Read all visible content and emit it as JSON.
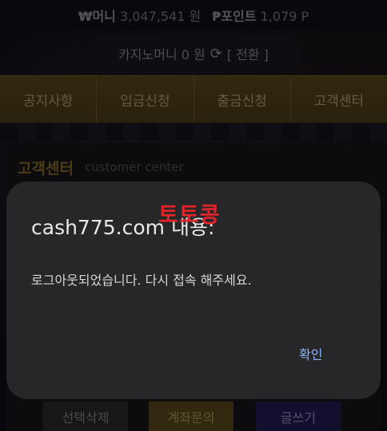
{
  "topbar": {
    "money_label": "₩머니",
    "money_value": "3,047,541 원",
    "point_label": "₱포인트",
    "point_value": "1,079 P"
  },
  "casino": {
    "label": "카지노머니 0 원",
    "swap_icon": "refresh-icon",
    "swap_label": "[ 전환 ]"
  },
  "nav": {
    "items": [
      {
        "label": "공지사항"
      },
      {
        "label": "입금신청"
      },
      {
        "label": "출금신청"
      },
      {
        "label": "고객센터"
      }
    ]
  },
  "panel": {
    "title": "고객센터",
    "subtitle": "customer center"
  },
  "bottom_buttons": {
    "delete_label": "선택삭제",
    "account_label": "계좌문의",
    "write_label": "글쓰기"
  },
  "dialog": {
    "title": "cash775.com 내용:",
    "watermark": "토토콩",
    "message": "로그아웃되었습니다.  다시 접속 해주세요.",
    "ok_label": "확인"
  },
  "colors": {
    "nav_gold": "#5a4a1e",
    "dialog_bg": "#27272a",
    "ok_blue": "#8ab4f8",
    "watermark_red": "#e0242a"
  }
}
